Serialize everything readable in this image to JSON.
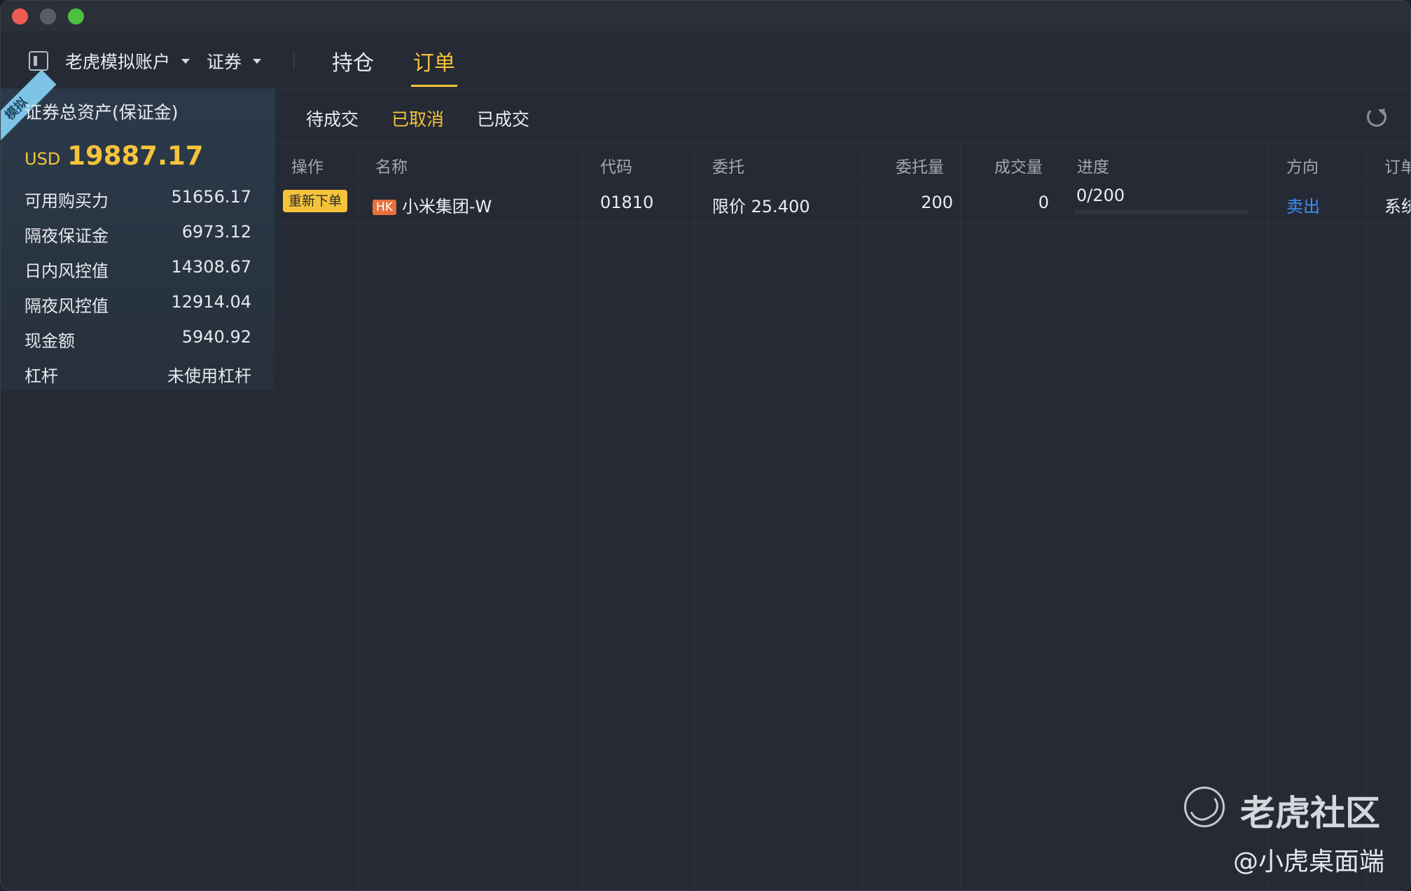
{
  "header": {
    "account_name": "老虎模拟账户",
    "account_type": "证券",
    "tabs": [
      {
        "label": "持仓",
        "active": false
      },
      {
        "label": "订单",
        "active": true
      }
    ]
  },
  "summary": {
    "ribbon": "模拟",
    "title": "证券总资产(保证金)",
    "currency": "USD",
    "total": "19887.17",
    "stats": [
      {
        "label": "可用购买力",
        "value": "51656.17"
      },
      {
        "label": "隔夜保证金",
        "value": "6973.12"
      },
      {
        "label": "日内风控值",
        "value": "14308.67"
      },
      {
        "label": "隔夜风控值",
        "value": "12914.04"
      },
      {
        "label": "现金额",
        "value": "5940.92"
      },
      {
        "label": "杠杆",
        "value": "未使用杠杆"
      }
    ]
  },
  "order_tabs": [
    {
      "label": "待成交",
      "active": false
    },
    {
      "label": "已取消",
      "active": true
    },
    {
      "label": "已成交",
      "active": false
    }
  ],
  "table": {
    "columns": [
      "操作",
      "名称",
      "代码",
      "委托",
      "委托量",
      "成交量",
      "进度",
      "方向",
      "订单"
    ],
    "rows": [
      {
        "action": "重新下单",
        "market": "HK",
        "name": "小米集团-W",
        "code": "01810",
        "order": "限价 25.400",
        "quantity": "200",
        "filled": "0",
        "progress": "0/200",
        "progress_fraction": 0,
        "direction": "卖出",
        "order_source": "系统"
      }
    ]
  },
  "watermark": {
    "brand": "老虎社区",
    "handle": "@小虎桌面端"
  },
  "colors": {
    "accent": "#f5c33b",
    "sell_blue": "#3e8ef7",
    "hk_badge": "#e8713b",
    "ribbon": "#7ec4e6"
  }
}
